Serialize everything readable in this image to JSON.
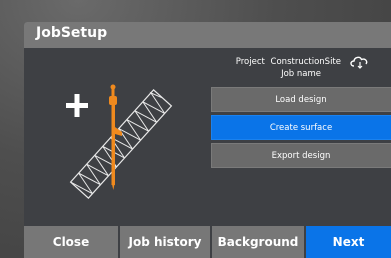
{
  "window": {
    "title": "JobSetup"
  },
  "info": {
    "project_label": "Project",
    "project_value": "ConstructionSite",
    "job_label": "Job name",
    "cloud_icon": "cloud-sync-icon"
  },
  "illustration": {
    "icon": "add-surface-icon"
  },
  "actions": {
    "load_design": "Load design",
    "create_surface": "Create surface",
    "export_design": "Export design"
  },
  "footer": {
    "close": "Close",
    "job_history": "Job history",
    "background": "Background",
    "next": "Next"
  },
  "colors": {
    "accent": "#0a74e8",
    "button_gray": "#6a6a6a",
    "titlebar": "#787878",
    "screen_bg": "#3e4044",
    "rod": "#f08a1e"
  }
}
